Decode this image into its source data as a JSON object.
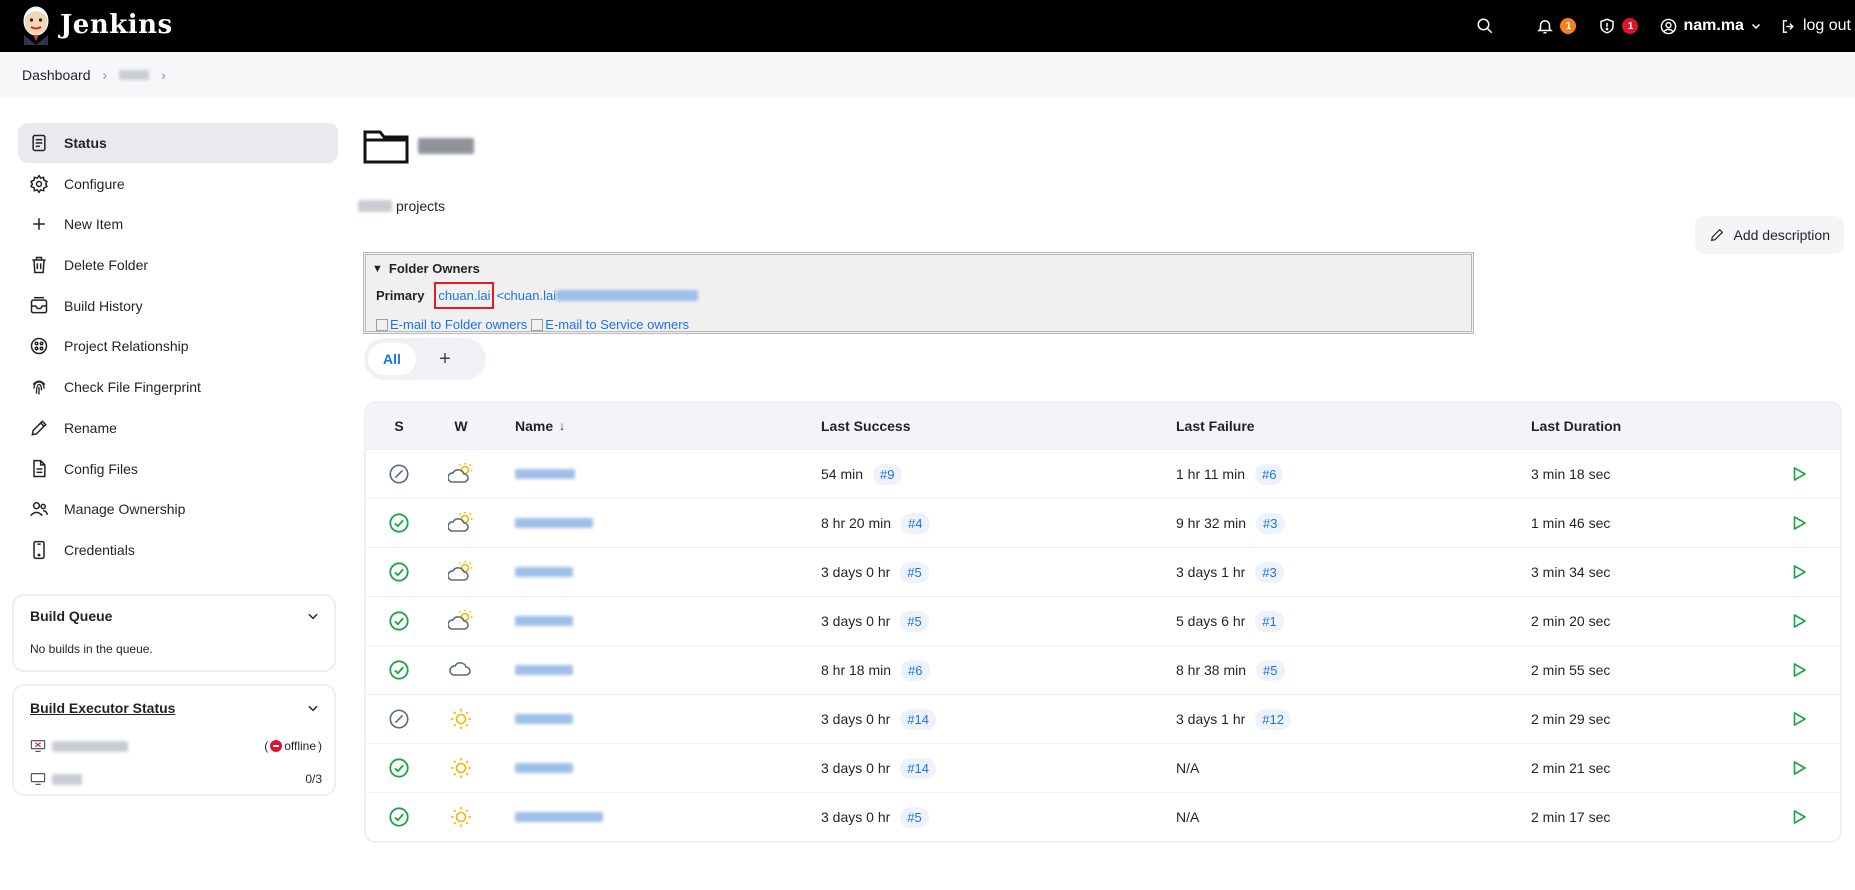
{
  "header": {
    "title": "Jenkins",
    "notifications_count": "1",
    "security_count": "1",
    "user": "nam.ma",
    "logout": "log out"
  },
  "breadcrumb": {
    "root": "Dashboard"
  },
  "sidebar": {
    "items": [
      {
        "label": "Status",
        "icon": "status-icon"
      },
      {
        "label": "Configure",
        "icon": "gear-icon"
      },
      {
        "label": "New Item",
        "icon": "plus-icon"
      },
      {
        "label": "Delete Folder",
        "icon": "trash-icon"
      },
      {
        "label": "Build History",
        "icon": "history-icon"
      },
      {
        "label": "Project Relationship",
        "icon": "relationship-icon"
      },
      {
        "label": "Check File Fingerprint",
        "icon": "fingerprint-icon"
      },
      {
        "label": "Rename",
        "icon": "pencil-icon"
      },
      {
        "label": "Config Files",
        "icon": "file-icon"
      },
      {
        "label": "Manage Ownership",
        "icon": "people-icon"
      },
      {
        "label": "Credentials",
        "icon": "phone-icon"
      }
    ],
    "build_queue": {
      "title": "Build Queue",
      "empty": "No builds in the queue."
    },
    "executor_status": {
      "title": "Build Executor Status",
      "node1_status": "offline",
      "node2_count": "0/3"
    }
  },
  "main": {
    "desc_suffix": "projects",
    "add_description": "Add description",
    "owners": {
      "heading": "Folder Owners",
      "primary_label": "Primary",
      "primary_user": "chuan.lai",
      "primary_email_prefix": "<chuan.lai",
      "email_folder": "E-mail to Folder owners",
      "email_service": "E-mail to Service owners"
    },
    "tabs": {
      "all": "All",
      "add": "+"
    },
    "table": {
      "headers": {
        "s": "S",
        "w": "W",
        "name": "Name",
        "sort_arrow": "↓",
        "last_success": "Last Success",
        "last_failure": "Last Failure",
        "last_duration": "Last Duration"
      },
      "rows": [
        {
          "status": "disabled",
          "weather": "partly-cloudy",
          "ls_time": "54 min",
          "ls_build": "#9",
          "lf_time": "1 hr 11 min",
          "lf_build": "#6",
          "duration": "3 min 18 sec"
        },
        {
          "status": "success",
          "weather": "partly-cloudy",
          "ls_time": "8 hr 20 min",
          "ls_build": "#4",
          "lf_time": "9 hr 32 min",
          "lf_build": "#3",
          "duration": "1 min 46 sec"
        },
        {
          "status": "success",
          "weather": "partly-cloudy",
          "ls_time": "3 days 0 hr",
          "ls_build": "#5",
          "lf_time": "3 days 1 hr",
          "lf_build": "#3",
          "duration": "3 min 34 sec"
        },
        {
          "status": "success",
          "weather": "partly-cloudy",
          "ls_time": "3 days 0 hr",
          "ls_build": "#5",
          "lf_time": "5 days 6 hr",
          "lf_build": "#1",
          "duration": "2 min 20 sec"
        },
        {
          "status": "success",
          "weather": "cloudy",
          "ls_time": "8 hr 18 min",
          "ls_build": "#6",
          "lf_time": "8 hr 38 min",
          "lf_build": "#5",
          "duration": "2 min 55 sec"
        },
        {
          "status": "disabled",
          "weather": "sunny",
          "ls_time": "3 days 0 hr",
          "ls_build": "#14",
          "lf_time": "3 days 1 hr",
          "lf_build": "#12",
          "duration": "2 min 29 sec"
        },
        {
          "status": "success",
          "weather": "sunny",
          "ls_time": "3 days 0 hr",
          "ls_build": "#14",
          "lf_time": "N/A",
          "lf_build": "",
          "duration": "2 min 21 sec"
        },
        {
          "status": "success",
          "weather": "sunny",
          "ls_time": "3 days 0 hr",
          "ls_build": "#5",
          "lf_time": "N/A",
          "lf_build": "",
          "duration": "2 min 17 sec"
        }
      ]
    }
  },
  "colors": {
    "success": "#1ea446",
    "disabled": "#5b6b82",
    "link": "#1a73e8",
    "notify_badge": "#f5821f",
    "security_badge": "#e0142c",
    "sun": "#f4b400"
  }
}
